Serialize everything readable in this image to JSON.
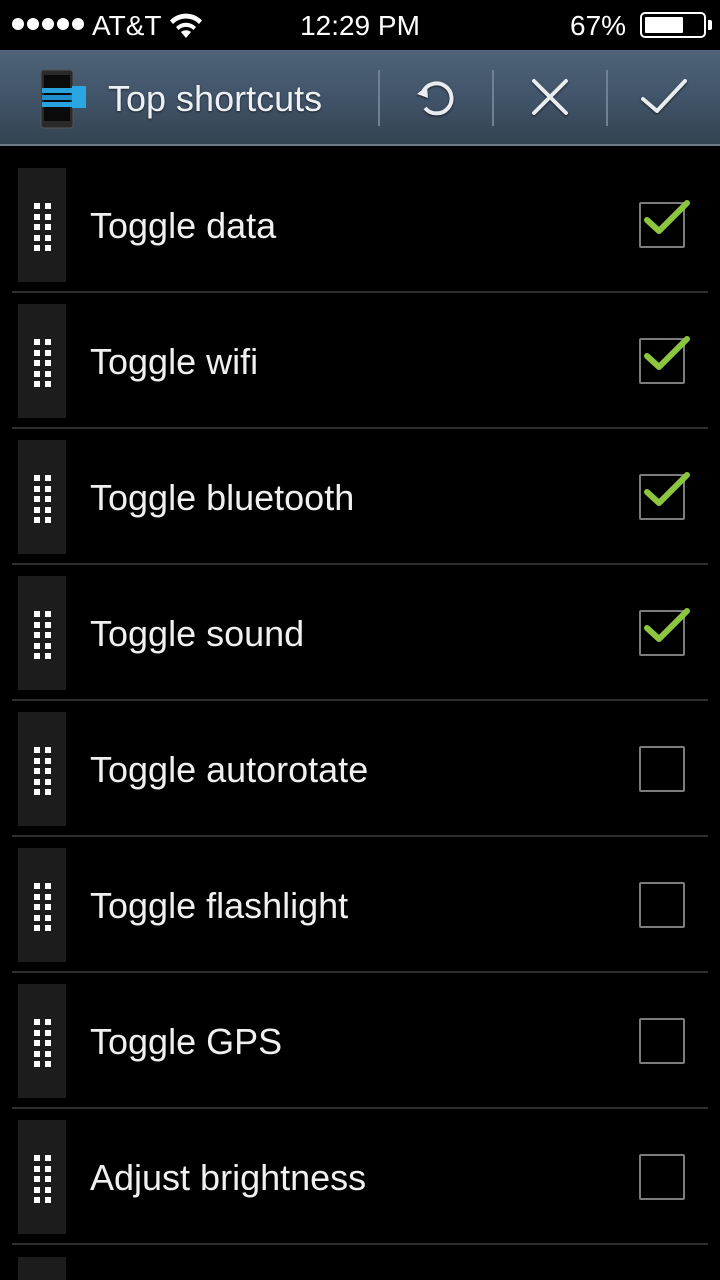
{
  "status_bar": {
    "signal_dots": 5,
    "carrier": "AT&T",
    "wifi_icon": "wifi-icon",
    "time": "12:29 PM",
    "battery_percent_text": "67%",
    "battery_level": 0.67
  },
  "action_bar": {
    "app_icon": "phone-shortcuts-icon",
    "title": "Top shortcuts",
    "buttons": [
      {
        "name": "reset",
        "icon": "undo-icon"
      },
      {
        "name": "cancel",
        "icon": "close-icon"
      },
      {
        "name": "done",
        "icon": "check-icon"
      }
    ]
  },
  "colors": {
    "action_bar_top": "#4f6478",
    "action_bar_bottom": "#34434f",
    "check_green": "#8cc63f",
    "checkbox_border": "#7c7c7c",
    "handle_bg": "#1c1c1c",
    "divider": "#2f2f2f"
  },
  "shortcuts": [
    {
      "label": "Toggle data",
      "checked": true
    },
    {
      "label": "Toggle wifi",
      "checked": true
    },
    {
      "label": "Toggle bluetooth",
      "checked": true
    },
    {
      "label": "Toggle sound",
      "checked": true
    },
    {
      "label": "Toggle autorotate",
      "checked": false
    },
    {
      "label": "Toggle flashlight",
      "checked": false
    },
    {
      "label": "Toggle GPS",
      "checked": false
    },
    {
      "label": "Adjust brightness",
      "checked": false
    }
  ]
}
